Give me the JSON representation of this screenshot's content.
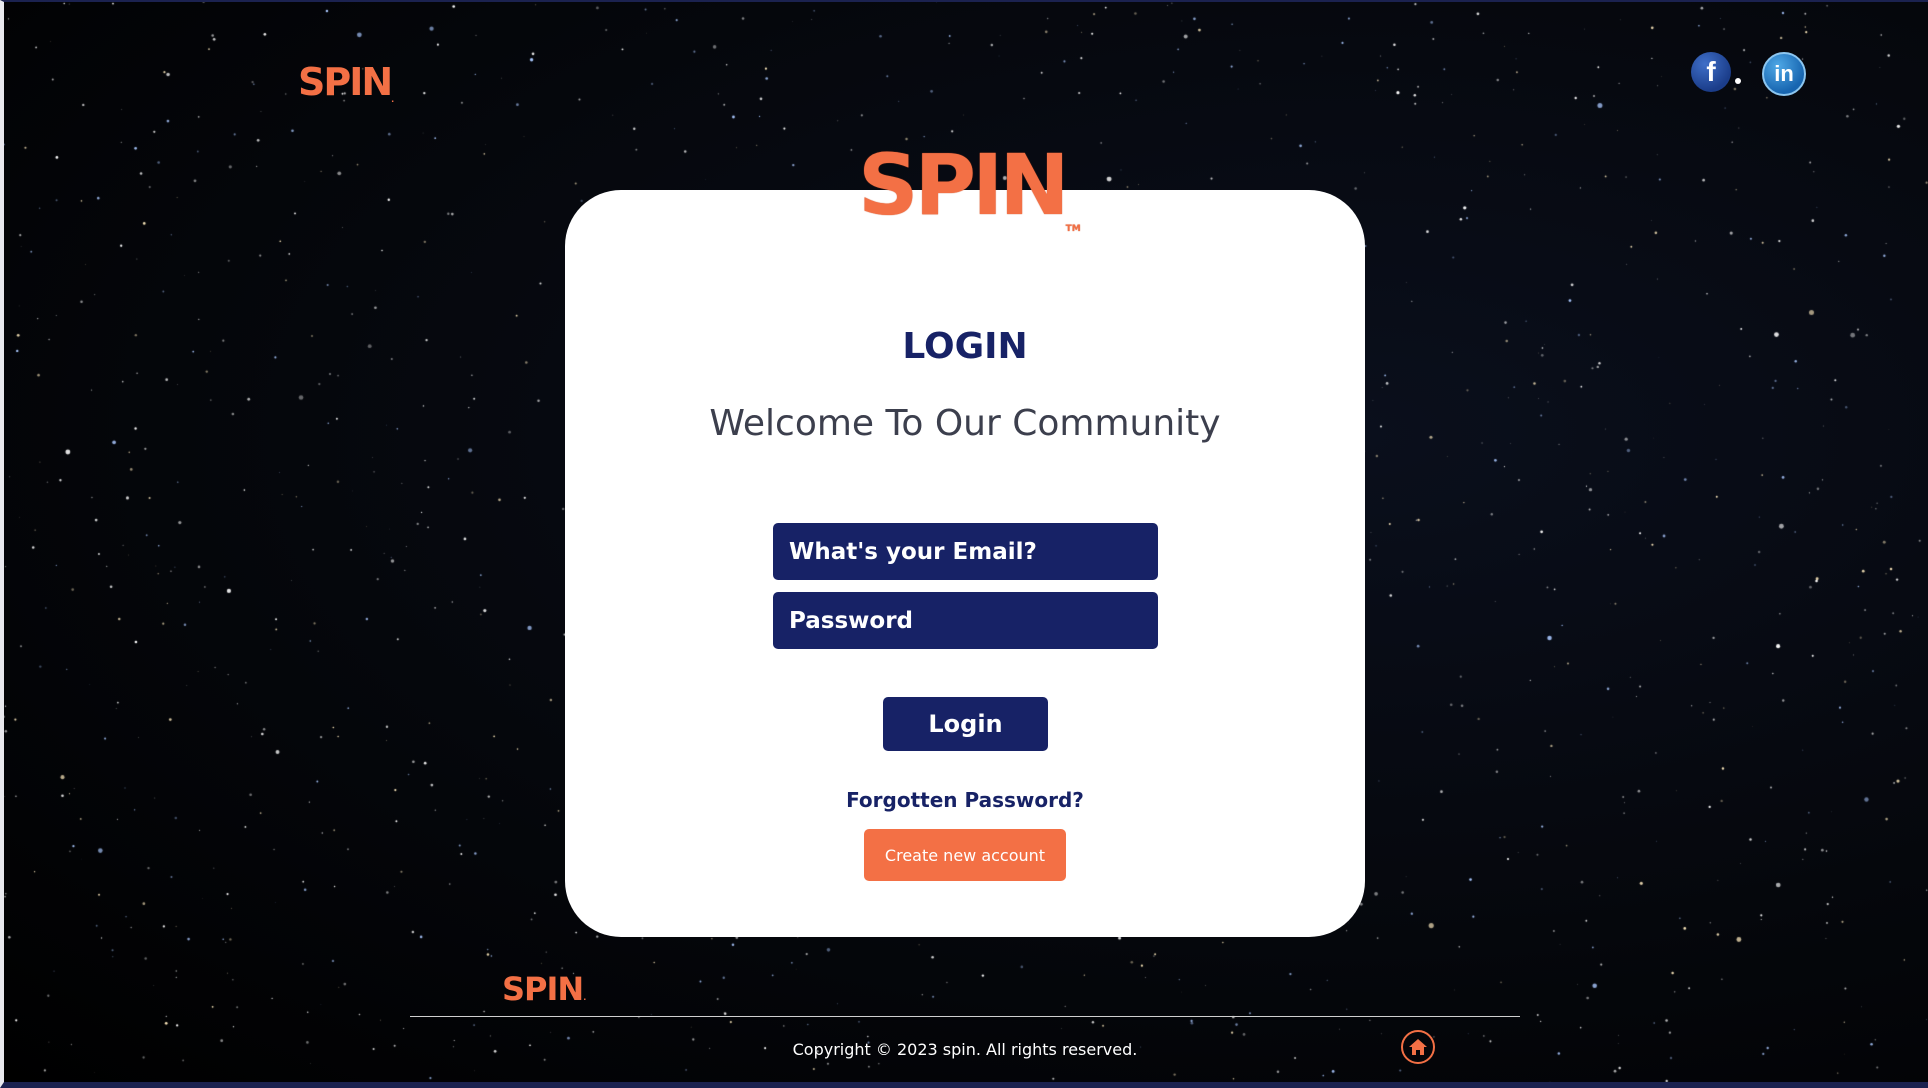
{
  "header": {
    "brand": "SPIN",
    "social": [
      {
        "name": "facebook",
        "glyph": "f"
      },
      {
        "name": "linkedin",
        "glyph": "in"
      }
    ]
  },
  "card": {
    "brand": "SPIN",
    "title": "LOGIN",
    "subtitle": "Welcome To Our Community",
    "email_placeholder": "What's your Email?",
    "password_placeholder": "Password",
    "login_label": "Login",
    "forgot_label": "Forgotten Password?",
    "create_label": "Create new account"
  },
  "footer": {
    "brand": "SPIN",
    "copyright": "Copyright © 2023 spin. All rights reserved."
  },
  "colors": {
    "navy": "#172266",
    "orange": "#f37045",
    "card": "#ffffff"
  },
  "icons": {
    "home": "home-icon"
  }
}
